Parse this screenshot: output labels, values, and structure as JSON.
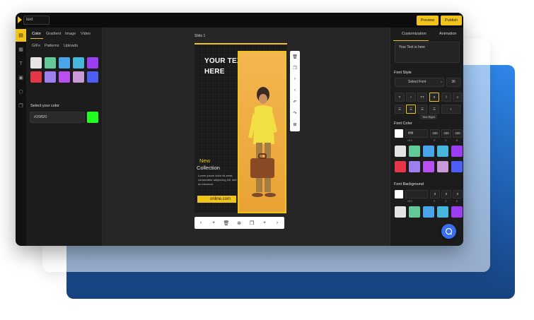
{
  "topbar": {
    "title_value": "text",
    "preview_label": "Preview",
    "publish_label": "Publish"
  },
  "left_panel": {
    "tabs": [
      "Color",
      "Gradient",
      "Image",
      "Video"
    ],
    "subtabs": [
      "GIFs",
      "Patterns",
      "Uploads"
    ],
    "swatches": [
      "#e4e4e4",
      "#62c997",
      "#4aa4ea",
      "#46b6da",
      "#9b3df0",
      "#e63746",
      "#9f7ef0",
      "#b94fef",
      "#c89ad8",
      "#4d5ef5"
    ],
    "select_color_label": "Select your color",
    "hex_value": "#20ff20"
  },
  "canvas": {
    "slide_label": "Slide 1",
    "headline": "YOUR TEXT IS HERE",
    "new_text": "New",
    "collection_text": "Collection",
    "body_text": "Lorem ipsum dolor sit amet, consectetur adipiscing elit, sed do eiusmod",
    "url_text": "online.com"
  },
  "right_panel": {
    "tabs": [
      "Customization",
      "Animation"
    ],
    "text_value": "Your Text is here",
    "font_style_title": "Font Style",
    "font_select_placeholder": "Select Font",
    "font_size": "36",
    "style_buttons": [
      "T",
      "I",
      "TT",
      "tt",
      "Ī",
      "≡"
    ],
    "align_tooltip": "Text Right",
    "align_extra": "I",
    "font_color_title": "Font Color",
    "font_color_hex": "ffffff",
    "font_color_rgb": [
      "255",
      "255",
      "255"
    ],
    "font_bg_title": "Font Background",
    "font_bg_rgb": [
      "0",
      "0",
      "0"
    ],
    "sub_labels": [
      "HEX",
      "R",
      "G",
      "B"
    ],
    "swatches_row1": [
      "#e4e4e4",
      "#62c997",
      "#4aa4ea",
      "#46b6da",
      "#9b3df0"
    ],
    "swatches_row2": [
      "#e63746",
      "#9f7ef0",
      "#b94fef",
      "#c89ad8",
      "#4d5ef5"
    ],
    "swatches_row3": [
      "#e4e4e4",
      "#62c997",
      "#4aa4ea",
      "#46b6da",
      "#9b3df0"
    ]
  },
  "colors": {
    "accent": "#f2c318",
    "chat": "#3b6ff0",
    "blue_bg": "#2f86e8"
  }
}
